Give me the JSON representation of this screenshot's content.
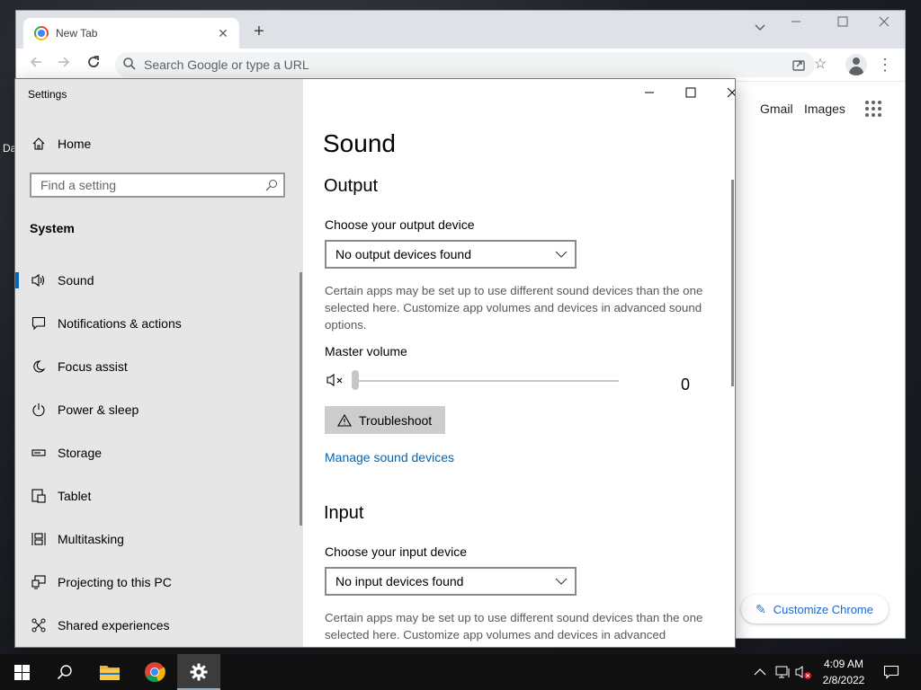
{
  "desktop": {
    "icon_label_fragment": "Da"
  },
  "chrome": {
    "tab_title": "New Tab",
    "omnibox_placeholder": "Search Google or type a URL",
    "ntp_links": {
      "gmail": "Gmail",
      "images": "Images"
    },
    "customize_label": "Customize Chrome",
    "accent": "#1a73e8"
  },
  "settings": {
    "window_title": "Settings",
    "home_label": "Home",
    "search_placeholder": "Find a setting",
    "section_header": "System",
    "nav_items": [
      {
        "label": "Sound",
        "icon": "speaker-icon",
        "active": true
      },
      {
        "label": "Notifications & actions",
        "icon": "notifications-icon",
        "active": false
      },
      {
        "label": "Focus assist",
        "icon": "moon-icon",
        "active": false
      },
      {
        "label": "Power & sleep",
        "icon": "power-icon",
        "active": false
      },
      {
        "label": "Storage",
        "icon": "storage-icon",
        "active": false
      },
      {
        "label": "Tablet",
        "icon": "tablet-icon",
        "active": false
      },
      {
        "label": "Multitasking",
        "icon": "multitasking-icon",
        "active": false
      },
      {
        "label": "Projecting to this PC",
        "icon": "projecting-icon",
        "active": false
      },
      {
        "label": "Shared experiences",
        "icon": "shared-icon",
        "active": false
      }
    ],
    "page_title": "Sound",
    "output": {
      "heading": "Output",
      "device_label": "Choose your output device",
      "device_value": "No output devices found",
      "description": "Certain apps may be set up to use different sound devices than the one selected here. Customize app volumes and devices in advanced sound options.",
      "master_volume_label": "Master volume",
      "volume_value": "0",
      "troubleshoot_label": "Troubleshoot",
      "manage_link": "Manage sound devices"
    },
    "input": {
      "heading": "Input",
      "device_label": "Choose your input device",
      "device_value": "No input devices found",
      "description": "Certain apps may be set up to use different sound devices than the one selected here. Customize app volumes and devices in advanced"
    },
    "accent": "#0067c0",
    "link_color": "#0066b4"
  },
  "taskbar": {
    "time": "4:09 AM",
    "date": "2/8/2022"
  }
}
